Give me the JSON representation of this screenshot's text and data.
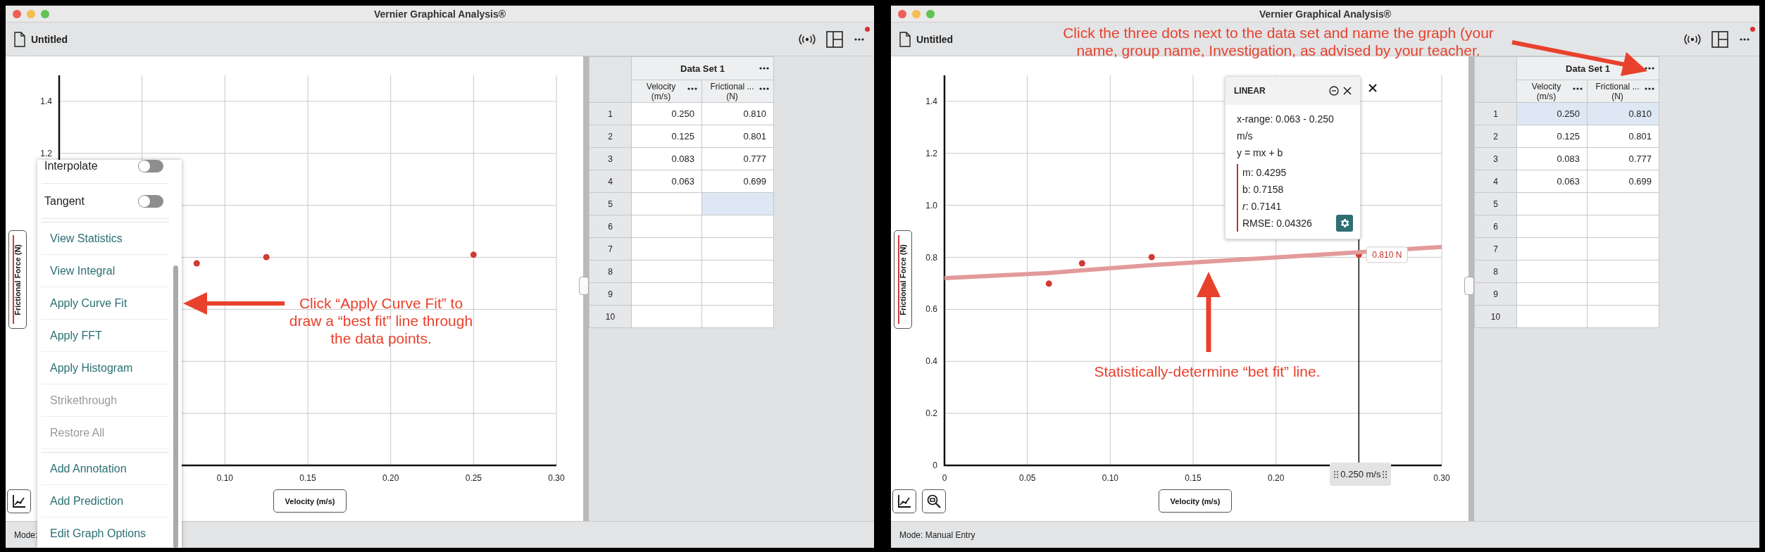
{
  "windows": [
    {
      "title": "Vernier Graphical Analysis®",
      "document": "Untitled",
      "graph": {
        "chart_data": {
          "type": "scatter",
          "xlabel": "Velocity (m/s)",
          "ylabel": "Frictional Force (N)",
          "grid": true,
          "x": [
            0.083,
            0.125,
            0.25
          ],
          "series": [
            {
              "color": "#d13a36",
              "values": [
                0.777,
                0.801,
                0.81
              ]
            }
          ],
          "xlim": [
            0,
            0.3
          ],
          "ylim": [
            0,
            1.5
          ],
          "yticks": [
            {
              "value": 1.2,
              "label": "1.2"
            },
            {
              "value": 1.4,
              "label": "1.4"
            }
          ],
          "xticks": [
            {
              "value": 0.1,
              "label": "0.10"
            },
            {
              "value": 0.15,
              "label": "0.15"
            },
            {
              "value": 0.2,
              "label": "0.20"
            },
            {
              "value": 0.25,
              "label": "0.25"
            },
            {
              "value": 0.3,
              "label": "0.30"
            }
          ]
        },
        "zoom_button": false
      },
      "menu": {
        "sections": [
          {
            "items": [
              {
                "kind": "toggle",
                "label": "Interpolate",
                "on": false
              },
              {
                "kind": "toggle",
                "label": "Tangent",
                "on": false
              }
            ]
          },
          {
            "items": [
              {
                "kind": "action",
                "label": "View Statistics",
                "disabled": false
              },
              {
                "kind": "action",
                "label": "View Integral",
                "disabled": false
              },
              {
                "kind": "action",
                "label": "Apply Curve Fit",
                "disabled": false
              },
              {
                "kind": "action",
                "label": "Apply FFT",
                "disabled": false
              },
              {
                "kind": "action",
                "label": "Apply Histogram",
                "disabled": false
              },
              {
                "kind": "action",
                "label": "Strikethrough",
                "disabled": true
              },
              {
                "kind": "action",
                "label": "Restore All",
                "disabled": true
              }
            ]
          },
          {
            "items": [
              {
                "kind": "action",
                "label": "Add Annotation",
                "disabled": false
              },
              {
                "kind": "action",
                "label": "Add Prediction",
                "disabled": false
              },
              {
                "kind": "action",
                "label": "Edit Graph Options",
                "disabled": false
              }
            ]
          }
        ]
      },
      "table": {
        "title": "Data Set 1",
        "columns": [
          {
            "name": "Velocity",
            "unit": "(m/s)"
          },
          {
            "name": "Frictional ...",
            "unit": "(N)"
          }
        ],
        "rows": [
          {
            "index": "1",
            "cells": [
              {
                "value": "0.250",
                "selected": false
              },
              {
                "value": "0.810",
                "selected": false
              }
            ]
          },
          {
            "index": "2",
            "cells": [
              {
                "value": "0.125",
                "selected": false
              },
              {
                "value": "0.801",
                "selected": false
              }
            ]
          },
          {
            "index": "3",
            "cells": [
              {
                "value": "0.083",
                "selected": false
              },
              {
                "value": "0.777",
                "selected": false
              }
            ]
          },
          {
            "index": "4",
            "cells": [
              {
                "value": "0.063",
                "selected": false
              },
              {
                "value": "0.699",
                "selected": false
              }
            ]
          },
          {
            "index": "5",
            "cells": [
              {
                "selected": false
              },
              {
                "selected": true
              }
            ]
          },
          {
            "index": "6",
            "cells": [
              {
                "selected": false
              },
              {
                "selected": false
              }
            ]
          },
          {
            "index": "7",
            "cells": [
              {
                "selected": false
              },
              {
                "selected": false
              }
            ]
          },
          {
            "index": "8",
            "cells": [
              {
                "selected": false
              },
              {
                "selected": false
              }
            ]
          },
          {
            "index": "9",
            "cells": [
              {
                "selected": false
              },
              {
                "selected": false
              }
            ]
          },
          {
            "index": "10",
            "cells": [
              {
                "selected": false
              },
              {
                "selected": false
              }
            ]
          }
        ]
      },
      "annotations": [
        {
          "kind": "menu-callout",
          "text": "Click “Apply Curve Fit” to\ndraw a “best fit” line through\nthe data points."
        }
      ],
      "status": "Mode:"
    },
    {
      "title": "Vernier Graphical Analysis®",
      "document": "Untitled",
      "graph": {
        "chart_data": {
          "type": "scatter",
          "xlabel": "Velocity (m/s)",
          "ylabel": "Frictional Force (N)",
          "grid": true,
          "x": [
            0,
            0.063,
            0.083,
            0.125,
            0.25,
            0.3
          ],
          "series": [
            {
              "color": "#d13a36",
              "values": [
                null,
                0.699,
                0.777,
                0.801,
                0.81,
                null
              ]
            },
            {
              "type": "line",
              "color": "#e39a9a",
              "values": [
                0.72,
                0.74,
                0.75,
                0.77,
                0.82,
                0.84
              ]
            }
          ],
          "xlim": [
            0,
            0.3
          ],
          "ylim": [
            0,
            1.5
          ],
          "xticks": [
            {
              "value": 0,
              "label": "0"
            },
            {
              "value": 0.05,
              "label": "0.05"
            },
            {
              "value": 0.1,
              "label": "0.10"
            },
            {
              "value": 0.15,
              "label": "0.15"
            },
            {
              "value": 0.2,
              "label": "0.20"
            },
            {
              "value": 0.3,
              "label": "0.30"
            }
          ],
          "yticks": [
            {
              "value": 0,
              "label": "0"
            },
            {
              "value": 0.2,
              "label": "0.2"
            },
            {
              "value": 0.4,
              "label": "0.4"
            },
            {
              "value": 0.6,
              "label": "0.6"
            },
            {
              "value": 0.8,
              "label": "0.8"
            },
            {
              "value": 1.0,
              "label": "1.0"
            },
            {
              "value": 1.2,
              "label": "1.2"
            },
            {
              "value": 1.4,
              "label": "1.4"
            }
          ],
          "ref_lines": [
            {
              "axis": "x",
              "value": 0.25,
              "label": "0.250 m/s"
            }
          ],
          "annotations": [
            {
              "x": 0.25,
              "y": 0.81,
              "text": "0.810 N"
            }
          ]
        },
        "zoom_button": true
      },
      "fit": {
        "title": "LINEAR",
        "lines": [
          "x-range: 0.063 - 0.250 m/s",
          "y = mx + b"
        ],
        "params": [
          "m: 0.4295",
          "b: 0.7158",
          "*r*: 0.7141",
          "RMSE: 0.04326"
        ]
      },
      "table": {
        "title": "Data Set 1",
        "columns": [
          {
            "name": "Velocity",
            "unit": "(m/s)"
          },
          {
            "name": "Frictional ...",
            "unit": "(N)"
          }
        ],
        "rows": [
          {
            "index": "1",
            "cells": [
              {
                "value": "0.250",
                "selected": true
              },
              {
                "value": "0.810",
                "selected": true
              }
            ]
          },
          {
            "index": "2",
            "cells": [
              {
                "value": "0.125",
                "selected": false
              },
              {
                "value": "0.801",
                "selected": false
              }
            ]
          },
          {
            "index": "3",
            "cells": [
              {
                "value": "0.083",
                "selected": false
              },
              {
                "value": "0.777",
                "selected": false
              }
            ]
          },
          {
            "index": "4",
            "cells": [
              {
                "value": "0.063",
                "selected": false
              },
              {
                "value": "0.699",
                "selected": false
              }
            ]
          },
          {
            "index": "5",
            "cells": [
              {
                "selected": false
              },
              {
                "selected": false
              }
            ]
          },
          {
            "index": "6",
            "cells": [
              {
                "selected": false
              },
              {
                "selected": false
              }
            ]
          },
          {
            "index": "7",
            "cells": [
              {
                "selected": false
              },
              {
                "selected": false
              }
            ]
          },
          {
            "index": "8",
            "cells": [
              {
                "selected": false
              },
              {
                "selected": false
              }
            ]
          },
          {
            "index": "9",
            "cells": [
              {
                "selected": false
              },
              {
                "selected": false
              }
            ]
          },
          {
            "index": "10",
            "cells": [
              {
                "selected": false
              },
              {
                "selected": false
              }
            ]
          }
        ]
      },
      "annotations": [
        {
          "kind": "dataset-callout",
          "text": "Click the three dots next to the data set and name the graph (your\nname, group name, Investigation, as advised by your teacher."
        },
        {
          "kind": "fit-callout",
          "text": "Statistically-determine “bet fit” line."
        }
      ],
      "status": "Mode: Manual Entry"
    }
  ]
}
